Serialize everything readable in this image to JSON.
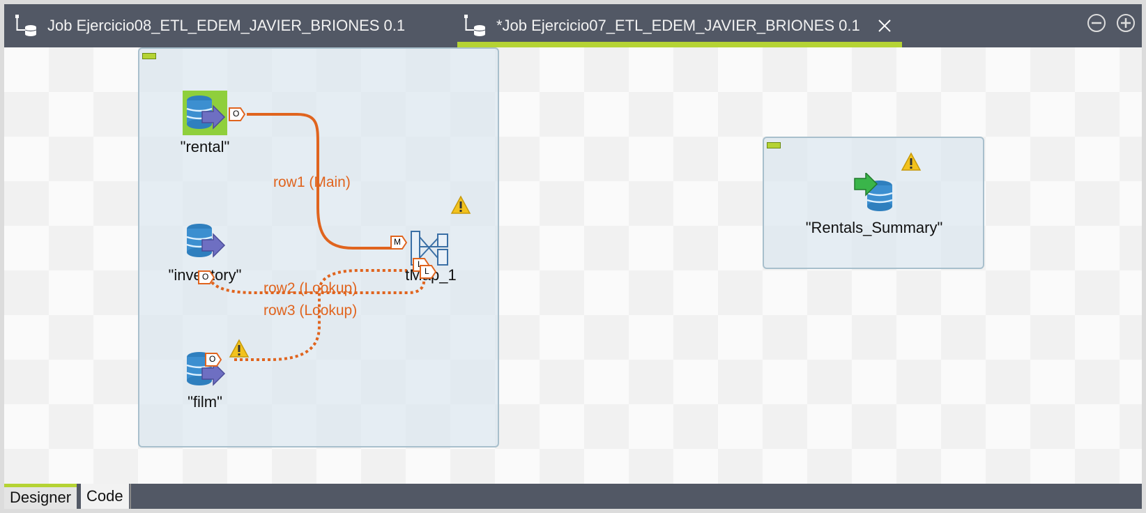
{
  "tabs": [
    {
      "label": "Job Ejercicio08_ETL_EDEM_JAVIER_BRIONES 0.1",
      "active": false
    },
    {
      "label": "*Job Ejercicio07_ETL_EDEM_JAVIER_BRIONES 0.1",
      "active": true
    }
  ],
  "components": {
    "rental": "\"rental\"",
    "inventory": "\"inventory\"",
    "film": "\"film\"",
    "tmap": "tMap_1",
    "rentals_summary": "\"Rentals_Summary\""
  },
  "links": {
    "row1": "row1 (Main)",
    "row2": "row2 (Lookup)",
    "row3": "row3 (Lookup)"
  },
  "ports": {
    "output": "O",
    "main": "M",
    "lookup": "L"
  },
  "bottom_tabs": {
    "designer": "Designer",
    "code": "Code"
  },
  "colors": {
    "accent": "#b5d334",
    "link": "#e0641e",
    "bar": "#525865"
  }
}
